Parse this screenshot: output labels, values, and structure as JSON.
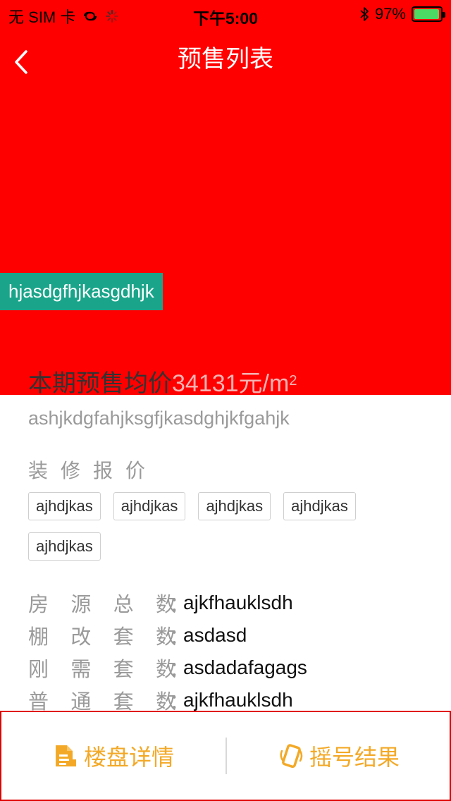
{
  "status_bar": {
    "carrier": "无 SIM 卡",
    "time": "下午5:00",
    "battery": "97%",
    "battery_level": 0.97,
    "battery_color": "#4cd964"
  },
  "nav": {
    "back_icon": "chevron-left-icon",
    "title": "预售列表"
  },
  "colors": {
    "header_bg": "#ff0000",
    "tag_bg": "#1aa58a",
    "accent": "#f3a927"
  },
  "banner_tag": "hjasdgfhjkasgdhjk",
  "price": {
    "label": "本期预售均价",
    "value": "34131",
    "unit": "元/m",
    "unit_sup": "2"
  },
  "subtitle": "ashjkdgfahjksgfjkasdghjkfgahjk",
  "decoration": {
    "label": "装修报价",
    "tags": [
      "ajhdjkas",
      "ajhdjkas",
      "ajhdjkas",
      "ajhdjkas",
      "ajhdjkas"
    ]
  },
  "info": [
    {
      "label": [
        "房",
        "源",
        "总",
        "数"
      ],
      "value": "ajkfhauklsdh"
    },
    {
      "label": [
        "棚",
        "改",
        "套",
        "数"
      ],
      "value": "asdasd"
    },
    {
      "label": [
        "刚",
        "需",
        "套",
        "数"
      ],
      "value": "asdadafagags"
    },
    {
      "label": [
        "普",
        "通",
        "套",
        "数"
      ],
      "value": "ajkfhauklsdh"
    }
  ],
  "info_colon": "：",
  "bottom": {
    "left": {
      "label": "楼盘详情",
      "icon": "document-icon"
    },
    "right": {
      "label": "摇号结果",
      "icon": "phone-shake-icon"
    }
  }
}
